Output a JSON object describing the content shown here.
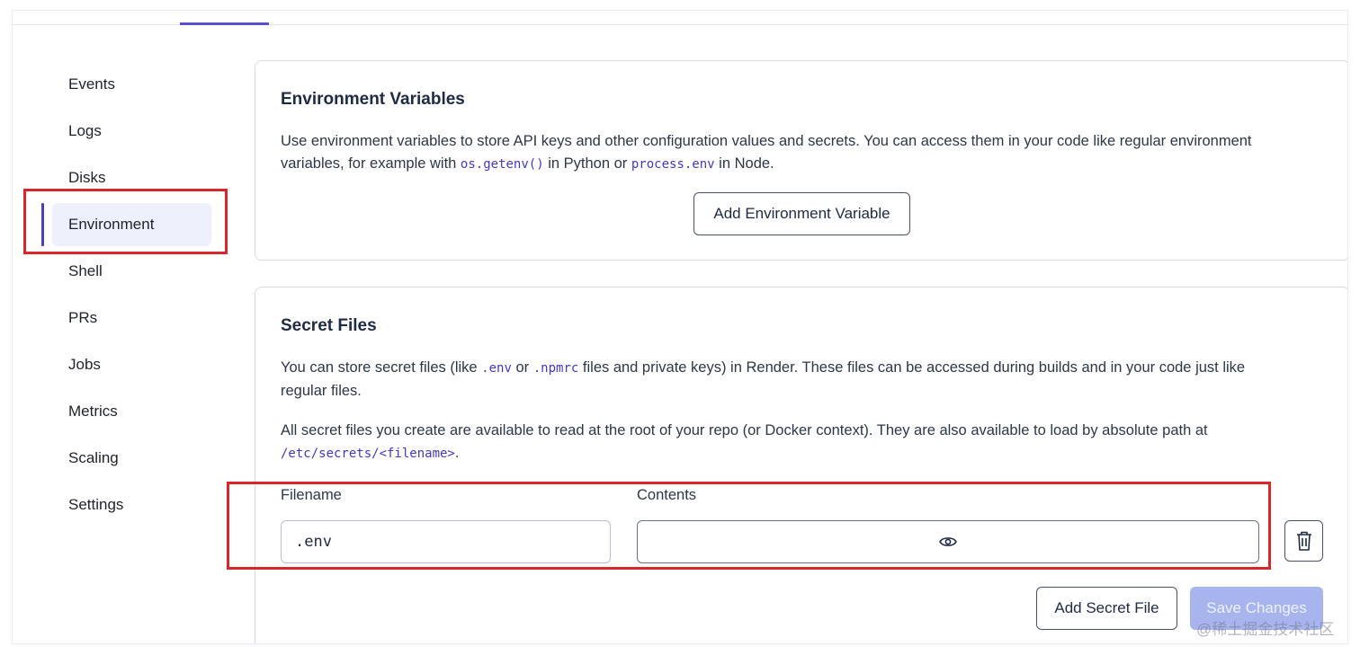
{
  "sidebar": {
    "items": [
      {
        "label": "Events"
      },
      {
        "label": "Logs"
      },
      {
        "label": "Disks"
      },
      {
        "label": "Environment"
      },
      {
        "label": "Shell"
      },
      {
        "label": "PRs"
      },
      {
        "label": "Jobs"
      },
      {
        "label": "Metrics"
      },
      {
        "label": "Scaling"
      },
      {
        "label": "Settings"
      }
    ],
    "active": "Environment"
  },
  "env_vars": {
    "title": "Environment Variables",
    "desc_1": "Use environment variables to store API keys and other configuration values and secrets. You can access them in your code like regular environment",
    "desc_2a": "variables, for example with ",
    "code_1": "os.getenv()",
    "desc_2b": " in Python or ",
    "code_2": "process.env",
    "desc_2c": " in Node.",
    "add_button": "Add Environment Variable"
  },
  "secret_files": {
    "title": "Secret Files",
    "desc_1a": "You can store secret files (like ",
    "code_env": ".env",
    "desc_1b": " or ",
    "code_npmrc": ".npmrc",
    "desc_1c": " files and private keys) in Render. These files can be accessed during builds and in your code just like",
    "desc_2": "regular files.",
    "desc_3": "All secret files you create are available to read at the root of your repo (or Docker context). They are also available to load by absolute path at",
    "code_path": "/etc/secrets/<filename>",
    "desc_4": ".",
    "filename_label": "Filename",
    "contents_label": "Contents",
    "filename_value": ".env",
    "contents_value": "",
    "add_button": "Add Secret File",
    "save_button": "Save Changes"
  },
  "watermark": "@稀土掘金技术社区",
  "colors": {
    "accent": "#4b3fc4",
    "highlight_box": "#d9262a",
    "save_disabled": "#a7b4ee"
  },
  "icons": [
    "eye-icon",
    "trash-icon"
  ]
}
